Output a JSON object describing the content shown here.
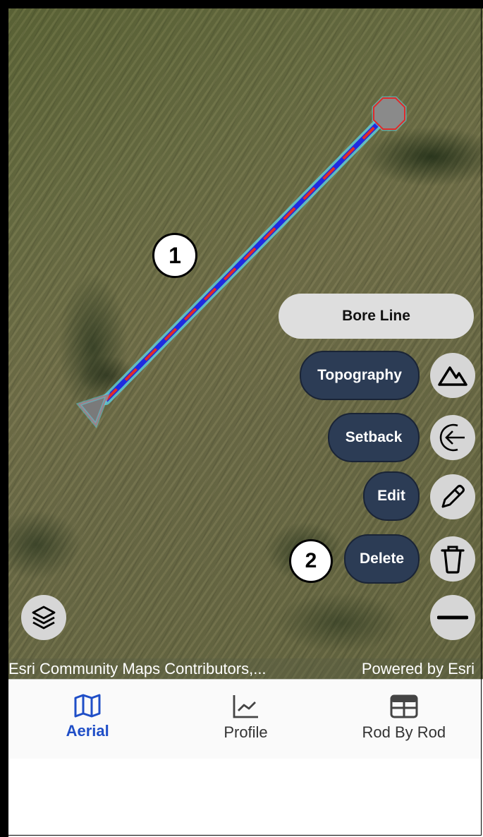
{
  "map": {
    "annotations": {
      "marker_1": "1",
      "marker_2": "2"
    },
    "colors": {
      "line_blue": "#1f2be0",
      "line_red": "#e02a2a",
      "glow": "#5fd6e8"
    },
    "attribution_left": "Esri Community Maps Contributors,...",
    "attribution_right": "Powered by Esri"
  },
  "actions": {
    "bore_line": "Bore Line",
    "topography": "Topography",
    "setback": "Setback",
    "edit": "Edit",
    "delete": "Delete",
    "icons": [
      "mountain-icon",
      "arrow-left-circle-icon",
      "pencil-icon",
      "trash-icon",
      "minus-icon",
      "layers-icon"
    ]
  },
  "tabs": [
    {
      "label": "Aerial",
      "icon": "map-icon",
      "active": true
    },
    {
      "label": "Profile",
      "icon": "line-chart-icon",
      "active": false
    },
    {
      "label": "Rod By Rod",
      "icon": "table-icon",
      "active": false
    }
  ],
  "accent_color": "#1f4ec7"
}
